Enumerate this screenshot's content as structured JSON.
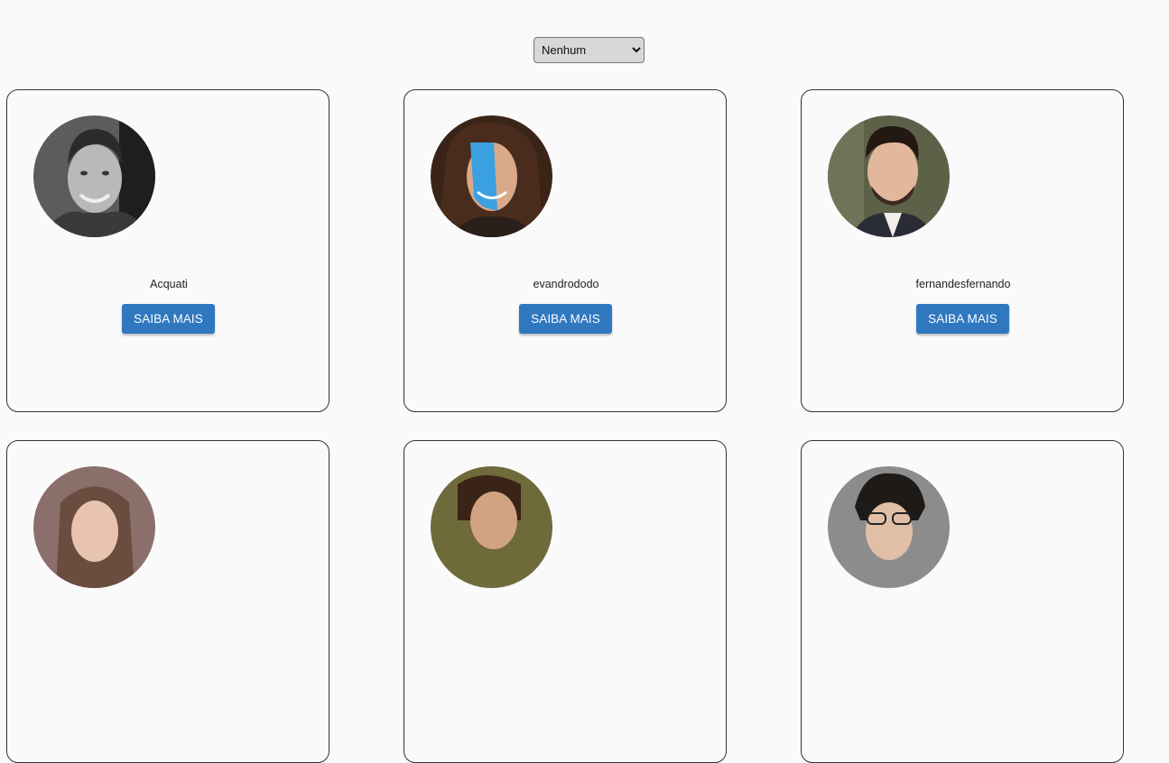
{
  "filter": {
    "selected": "Nenhum",
    "options": [
      "Nenhum"
    ]
  },
  "profiles": [
    {
      "username": "Acquati",
      "button_label": "SAIBA MAIS",
      "avatar": "avatar-photo"
    },
    {
      "username": "evandrododo",
      "button_label": "SAIBA MAIS",
      "avatar": "avatar-photo"
    },
    {
      "username": "fernandesfernando",
      "button_label": "SAIBA MAIS",
      "avatar": "avatar-photo"
    },
    {
      "username": "",
      "button_label": "",
      "avatar": "avatar-photo"
    },
    {
      "username": "",
      "button_label": "",
      "avatar": "avatar-photo"
    },
    {
      "username": "",
      "button_label": "",
      "avatar": "avatar-photo"
    }
  ],
  "colors": {
    "background": "#fafafa",
    "card_border": "#333333",
    "button": "#2f78c0",
    "button_text": "#ffffff"
  }
}
